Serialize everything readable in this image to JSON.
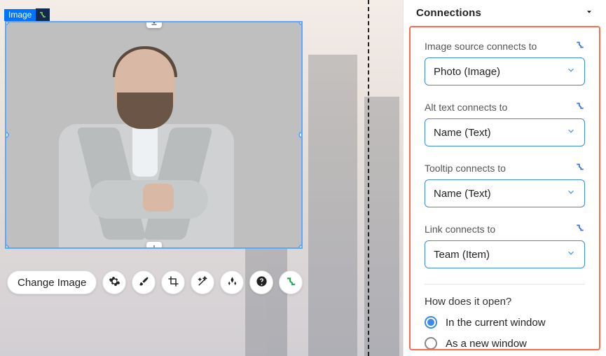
{
  "canvas": {
    "badge": "Image"
  },
  "toolbar": {
    "change_image": "Change Image"
  },
  "panel": {
    "title": "Connections",
    "fields": [
      {
        "label": "Image source connects to",
        "value": "Photo (Image)"
      },
      {
        "label": "Alt text connects to",
        "value": "Name (Text)"
      },
      {
        "label": "Tooltip connects to",
        "value": "Name (Text)"
      },
      {
        "label": "Link connects to",
        "value": "Team (Item)"
      }
    ],
    "open_question": "How does it open?",
    "open_options": [
      {
        "label": "In the current window",
        "selected": true
      },
      {
        "label": "As a new window",
        "selected": false
      }
    ]
  },
  "icons": {
    "connect": "connect-icon"
  }
}
